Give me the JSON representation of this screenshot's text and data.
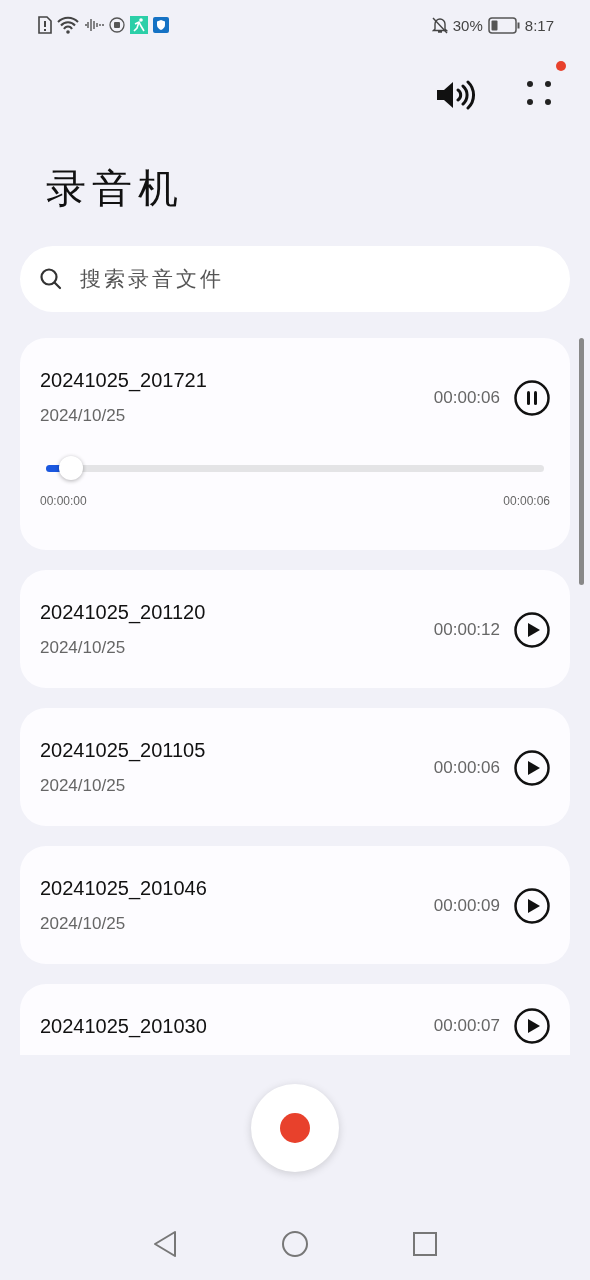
{
  "status_bar": {
    "battery_text": "30%",
    "time": "8:17"
  },
  "toolbar": {
    "menu_badge": true
  },
  "title": "录音机",
  "search": {
    "placeholder": "搜索录音文件"
  },
  "recordings": [
    {
      "name": "20241025_201721",
      "date": "2024/10/25",
      "duration": "00:00:06",
      "playing": true,
      "expanded": true,
      "level": 0.05,
      "position": "00:00:00",
      "total": "00:00:06"
    },
    {
      "name": "20241025_201120",
      "date": "2024/10/25",
      "duration": "00:00:12",
      "playing": false,
      "expanded": false
    },
    {
      "name": "20241025_201105",
      "date": "2024/10/25",
      "duration": "00:00:06",
      "playing": false,
      "expanded": false
    },
    {
      "name": "20241025_201046",
      "date": "2024/10/25",
      "duration": "00:00:09",
      "playing": false,
      "expanded": false
    },
    {
      "name": "20241025_201030",
      "duration": "00:00:07",
      "playing": false,
      "expanded": false
    }
  ]
}
